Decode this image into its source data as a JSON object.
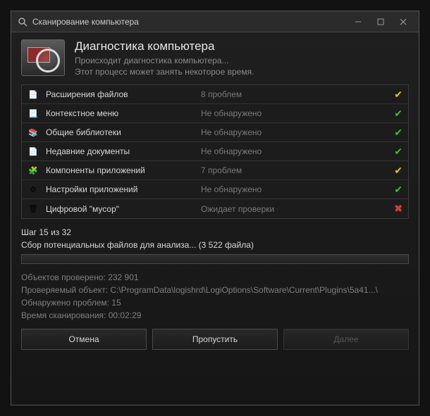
{
  "titlebar": {
    "title": "Сканирование компьютера"
  },
  "header": {
    "title": "Диагностика компьютера",
    "line1": "Происходит диагностика компьютера...",
    "line2": "Этот процесс может занять некоторое время."
  },
  "rows": [
    {
      "icon": "📄",
      "label": "Расширения файлов",
      "status": "8 проблем",
      "mark": "✔",
      "markClass": "mark-yellow"
    },
    {
      "icon": "📃",
      "label": "Контекстное меню",
      "status": "Не обнаружено",
      "mark": "✔",
      "markClass": "mark-green"
    },
    {
      "icon": "📚",
      "label": "Общие библиотеки",
      "status": "Не обнаружено",
      "mark": "✔",
      "markClass": "mark-green"
    },
    {
      "icon": "📄",
      "label": "Недавние документы",
      "status": "Не обнаружено",
      "mark": "✔",
      "markClass": "mark-green"
    },
    {
      "icon": "🧩",
      "label": "Компоненты приложений",
      "status": "7 проблем",
      "mark": "✔",
      "markClass": "mark-yellow"
    },
    {
      "icon": "⚙",
      "label": "Настройки приложений",
      "status": "Не обнаружено",
      "mark": "✔",
      "markClass": "mark-green"
    },
    {
      "icon": "🗑",
      "label": "Цифровой \"мусор\"",
      "status": "Ожидает проверки",
      "mark": "✖",
      "markClass": "mark-red"
    }
  ],
  "progress": {
    "step": "Шаг 15 из 32",
    "action": "Сбор потенциальных файлов для анализа... (3 522 файла)"
  },
  "stats": {
    "objects": "Объектов проверено: 232 901",
    "current": "Проверяемый объект: C:\\ProgramData\\logishrd\\LogiOptions\\Software\\Current\\Plugins\\5a41...\\",
    "problems": "Обнаружено проблем: 15",
    "time": "Время сканирования: 00:02:29"
  },
  "buttons": {
    "cancel": "Отмена",
    "skip": "Пропустить",
    "next": "Далее"
  }
}
